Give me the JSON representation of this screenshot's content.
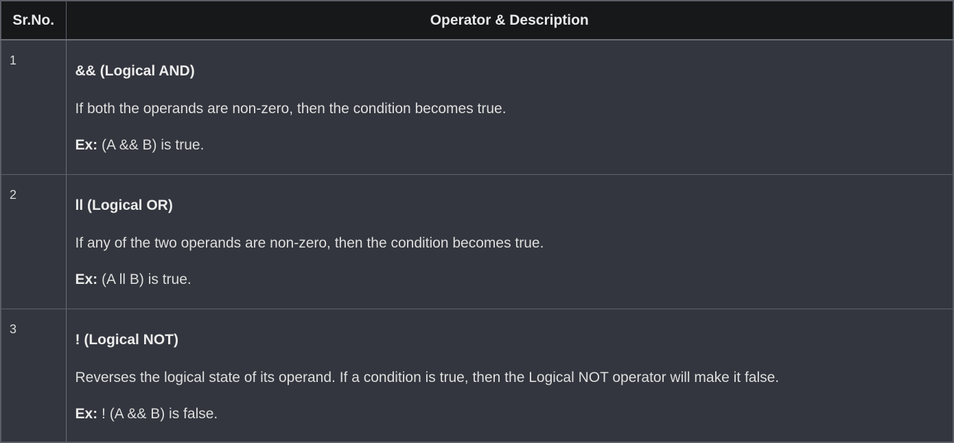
{
  "table": {
    "headers": {
      "number": "Sr.No.",
      "description": "Operator & Description"
    },
    "rows": [
      {
        "number": "1",
        "operator": "&& (Logical AND)",
        "description": "If both the operands are non-zero, then the condition becomes true.",
        "example_label": "Ex:",
        "example": " (A && B) is true."
      },
      {
        "number": "2",
        "operator": "ll (Logical OR)",
        "description": "If any of the two operands are non-zero, then the condition becomes true.",
        "example_label": "Ex:",
        "example": " (A ll B) is true."
      },
      {
        "number": "3",
        "operator": "! (Logical NOT)",
        "description": "Reverses the logical state of its operand. If a condition is true, then the Logical NOT operator will make it false.",
        "example_label": "Ex:",
        "example": " ! (A && B) is false."
      }
    ]
  },
  "colors": {
    "background": "#33363e",
    "header_background": "#17181a",
    "border": "#5f636b",
    "text": "#dedede"
  }
}
